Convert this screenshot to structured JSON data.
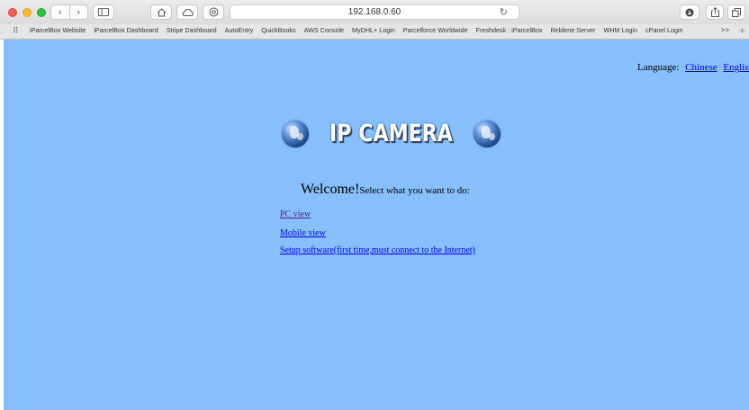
{
  "browser": {
    "address": "192.168.0.60",
    "bookmarks": [
      "iParcelBox Website",
      "iParcelBox Dashboard",
      "Stripe Dashboard",
      "AutoEntry",
      "QuickBooks",
      "AWS Console",
      "MyDHL+ Login",
      "Parcelforce Worldwide",
      "Freshdesk : iParcelBox",
      "Reldene Server",
      "WHM Login",
      "cPanel Login"
    ],
    "more": ">>",
    "icons": {
      "back": "chevron-left-icon",
      "forward": "chevron-right-icon",
      "sidebar": "sidebar-icon",
      "home": "home-icon",
      "cloud": "cloud-icon",
      "shield": "privacy-icon",
      "reload": "reload-icon",
      "download": "download-icon",
      "share": "share-icon",
      "tabs": "tabs-icon"
    }
  },
  "page": {
    "background": "#86bffb",
    "language_label": "Language:",
    "language_chinese": "Chinese",
    "language_english": "English",
    "banner_title": "IP CAMERA",
    "welcome": "Welcome!",
    "instruction": "Select what you want to do:",
    "links": {
      "pc_view": "PC view",
      "mobile_view": "Mobile view",
      "setup": "Setup software(first time,must connect to the Internet)"
    }
  }
}
